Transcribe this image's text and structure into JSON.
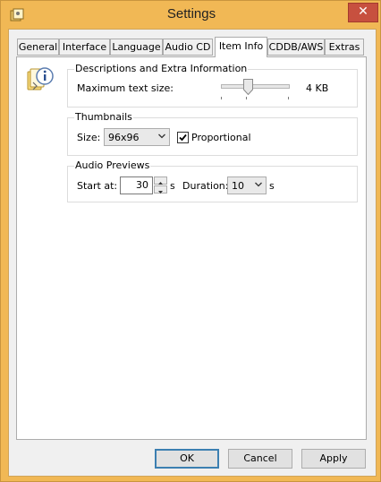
{
  "window": {
    "title": "Settings",
    "close_glyph": "✕"
  },
  "tabs": [
    {
      "label": "General",
      "active": false
    },
    {
      "label": "Interface",
      "active": false
    },
    {
      "label": "Language",
      "active": false
    },
    {
      "label": "Audio CD",
      "active": false
    },
    {
      "label": "Item Info",
      "active": true
    },
    {
      "label": "CDDB/AWS",
      "active": false
    },
    {
      "label": "Extras",
      "active": false
    }
  ],
  "descriptions_group": {
    "title": "Descriptions and Extra Information",
    "max_text_size_label": "Maximum text size:",
    "max_text_size_value": "4 KB",
    "slider_fraction": 0.4
  },
  "thumbnails_group": {
    "title": "Thumbnails",
    "size_label": "Size:",
    "size_value": "96x96",
    "proportional_label": "Proportional",
    "proportional_checked": true
  },
  "audio_previews_group": {
    "title": "Audio Previews",
    "start_at_label": "Start at:",
    "start_at_value": "30",
    "start_unit": "s",
    "duration_label": "Duration:",
    "duration_value": "10",
    "duration_unit": "s"
  },
  "buttons": {
    "ok": "OK",
    "cancel": "Cancel",
    "apply": "Apply"
  },
  "icons": {
    "app": "settings-app-icon",
    "info": "info-icon"
  },
  "colors": {
    "titlebar": "#f1b855",
    "close": "#c7503f",
    "panel": "#ffffff",
    "default_button_border": "#3c7fb1"
  }
}
